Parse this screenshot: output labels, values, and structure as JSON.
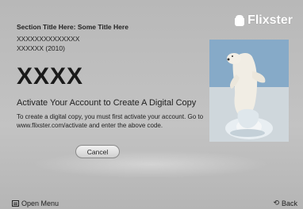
{
  "brand": {
    "name": "Flixster",
    "icon": "popcorn-icon"
  },
  "content": {
    "section_title": "Section Title Here: Some Title Here",
    "title_line": "XXXXXXXXXXXXXX",
    "year_line": "XXXXXX (2010)",
    "code": "XXXX",
    "heading": "Activate Your Account to Create A Digital Copy",
    "description": "To create a digital copy, you must first activate your account. Go to www.flixster.com/activate and enter the above code."
  },
  "buttons": {
    "cancel": "Cancel"
  },
  "footer": {
    "open_menu": "Open Menu",
    "open_menu_icon": "menu-icon",
    "back": "Back",
    "back_icon": "return-arrow-icon"
  },
  "image": {
    "subject": "polar bear on ice",
    "icon": "polar-bear-image"
  }
}
